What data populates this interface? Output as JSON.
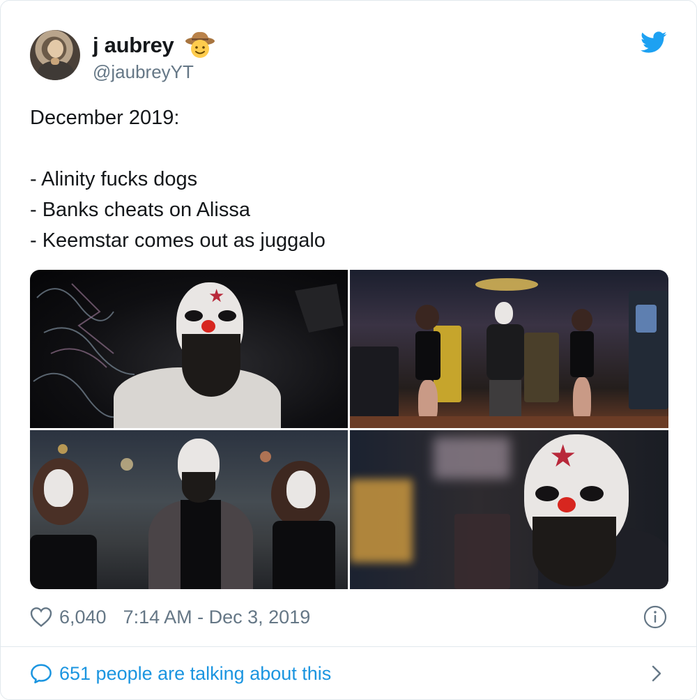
{
  "user": {
    "name": "j aubrey",
    "handle": "@jaubreyYT",
    "name_emoji": "cowboy-hat-face-emoji"
  },
  "tweet": {
    "lines": [
      "December 2019:",
      "",
      "- Alinity fucks dogs",
      "- Banks cheats on Alissa",
      "- Keemstar comes out as juggalo"
    ]
  },
  "media": {
    "count": 4
  },
  "meta": {
    "likes": "6,040",
    "timestamp": "7:14 AM - Dec 3, 2019"
  },
  "footer": {
    "talking": "651 people are talking about this"
  },
  "colors": {
    "link": "#1b95e0",
    "secondary_text": "#657786",
    "twitter_blue": "#1da1f2",
    "border": "#e1e8ed"
  },
  "icons": {
    "brand": "twitter-bird-icon",
    "like": "heart-icon",
    "info": "info-icon",
    "reply": "speech-bubble-icon",
    "more": "chevron-right-icon"
  }
}
